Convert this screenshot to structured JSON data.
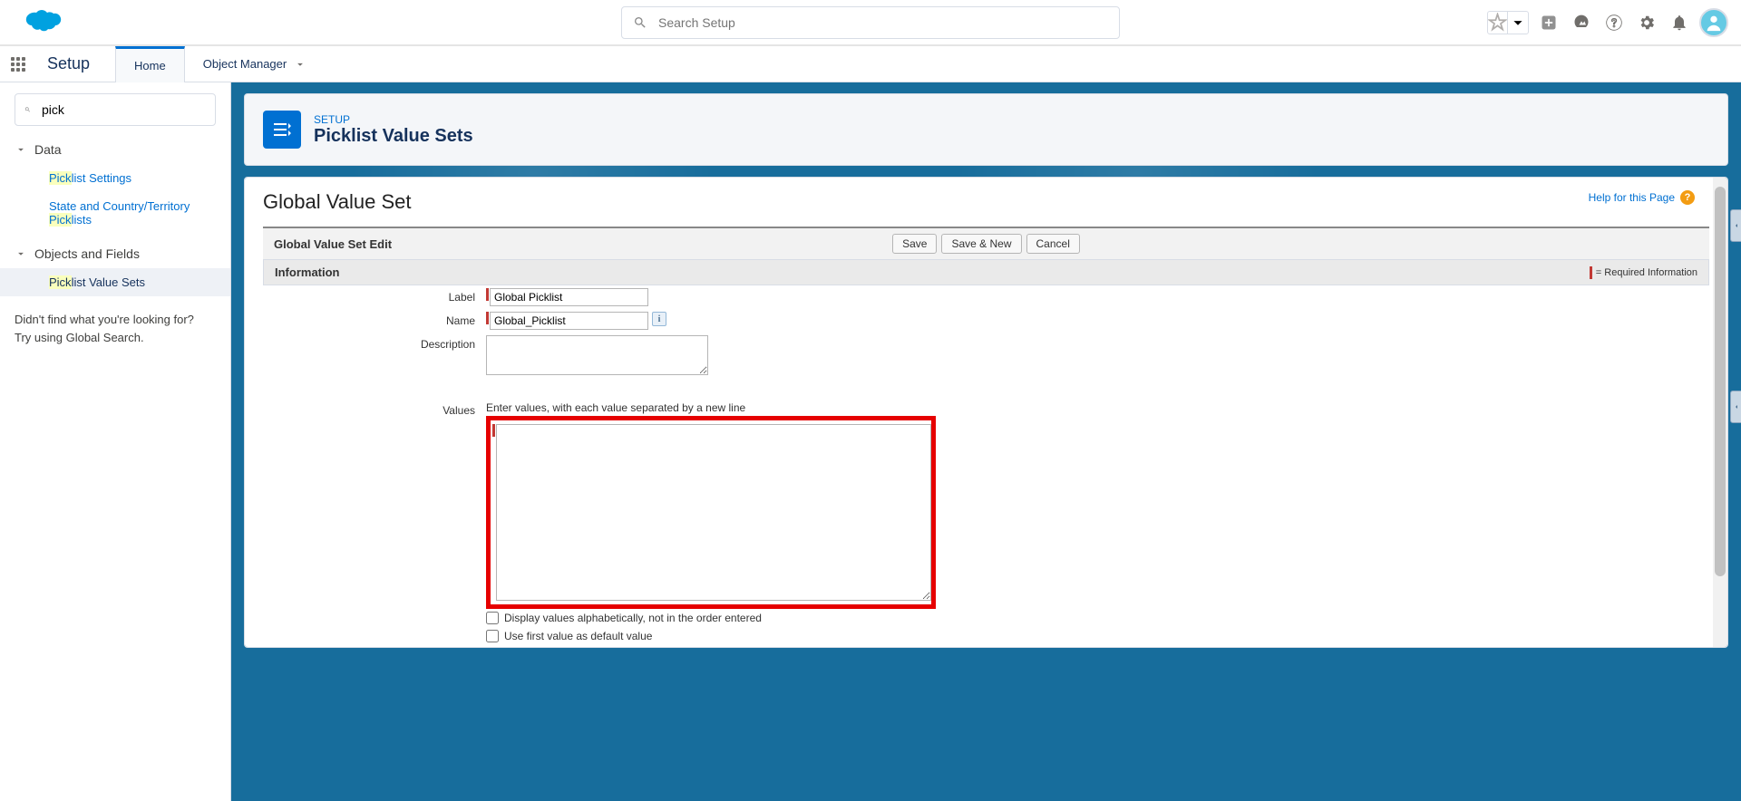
{
  "header": {
    "search_placeholder": "Search Setup"
  },
  "context": {
    "app_name": "Setup",
    "tabs": [
      {
        "label": "Home",
        "active": true
      },
      {
        "label": "Object Manager",
        "active": false
      }
    ]
  },
  "sidebar": {
    "search_value": "pick",
    "groups": [
      {
        "label": "Data",
        "items": [
          {
            "label_pre": "Pick",
            "label_post": "list Settings",
            "active": false
          },
          {
            "label_pre_line1": "State and Country/Territory",
            "label_pre": "Pick",
            "label_post": "lists",
            "active": false
          }
        ]
      },
      {
        "label": "Objects and Fields",
        "items": [
          {
            "label_pre": "Pick",
            "label_post": "list Value Sets",
            "active": true
          }
        ]
      }
    ],
    "footer_line1": "Didn't find what you're looking for?",
    "footer_line2": "Try using Global Search."
  },
  "page": {
    "eyebrow": "SETUP",
    "title": "Picklist Value Sets",
    "help_link": "Help for this Page",
    "panel_title": "Global Value Set",
    "section_edit": "Global Value Set Edit",
    "section_info": "Information",
    "required_note": "= Required Information",
    "buttons": {
      "save": "Save",
      "save_new": "Save & New",
      "cancel": "Cancel"
    },
    "form": {
      "label_label": "Label",
      "label_value": "Global Picklist",
      "name_label": "Name",
      "name_value": "Global_Picklist",
      "description_label": "Description",
      "description_value": "",
      "values_label": "Values",
      "values_hint": "Enter values, with each value separated by a new line",
      "values_value": "",
      "cb_alpha": "Display values alphabetically, not in the order entered",
      "cb_default": "Use first value as default value"
    }
  }
}
